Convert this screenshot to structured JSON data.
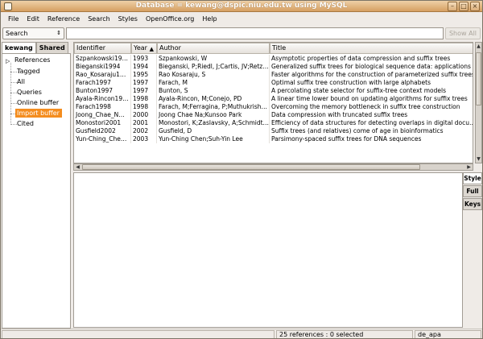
{
  "window": {
    "title": "Database = kewang@dspic.niu.edu.tw using MySQL"
  },
  "menu": [
    "File",
    "Edit",
    "Reference",
    "Search",
    "Styles",
    "OpenOffice.org",
    "Help"
  ],
  "toolbar": {
    "search_mode": "Search",
    "search_value": "",
    "show_all_label": "Show All"
  },
  "tabs": [
    {
      "label": "kewang",
      "active": true
    },
    {
      "label": "Shared",
      "active": false
    }
  ],
  "tree": {
    "root": "References",
    "children": [
      "Tagged",
      "All",
      "Queries",
      "Online buffer",
      "Import buffer",
      "Cited"
    ],
    "selected": "Import buffer"
  },
  "table": {
    "columns": [
      "Identifier",
      "Year",
      "Author",
      "Title"
    ],
    "sort_column": "Year",
    "rows": [
      [
        "Szpankowski19…",
        "1993",
        "Szpankowski, W",
        "Asymptotic properties of data compression and suffix trees"
      ],
      [
        "Bieganski1994",
        "1994",
        "Bieganski, P;Riedl, J;Cartis, JV;Retz…",
        "Generalized suffix trees for biological sequence data: applications …"
      ],
      [
        "Rao_Kosaraju1…",
        "1995",
        "Rao Kosaraju, S",
        "Faster algorithms for the construction of parameterized suffix trees"
      ],
      [
        "Farach1997",
        "1997",
        "Farach, M",
        "Optimal suffix tree construction with large alphabets"
      ],
      [
        "Bunton1997",
        "1997",
        "Bunton, S",
        "A percolating state selector for suffix-tree context models"
      ],
      [
        "Ayala-Rincon19…",
        "1998",
        "Ayala-Rincon, M;Conejo, PD",
        "A linear time lower bound on updating algorithms for suffix trees"
      ],
      [
        "Farach1998",
        "1998",
        "Farach, M;Ferragina, P;Muthukrish…",
        "Overcoming the memory bottleneck in suffix tree construction"
      ],
      [
        "Joong_Chae_N…",
        "2000",
        "Joong Chae Na;Kunsoo Park",
        "Data compression with truncated suffix trees"
      ],
      [
        "Monostori2001",
        "2001",
        "Monostori, K;Zaslavsky, A;Schmidt…",
        "Efficiency of data structures for detecting overlaps in digital docu…"
      ],
      [
        "Gusfield2002",
        "2002",
        "Gusfield, D",
        "Suffix trees (and relatives) come of age in bioinformatics"
      ],
      [
        "Yun-Ching_Che…",
        "2003",
        "Yun-Ching Chen;Suh-Yin Lee",
        "Parsimony-spaced suffix trees for DNA sequences"
      ]
    ]
  },
  "side_tabs": [
    {
      "label": "Style",
      "active": true
    },
    {
      "label": "Full",
      "active": false
    },
    {
      "label": "Keys",
      "active": false
    }
  ],
  "status": {
    "left": "",
    "count": "25 references : 0 selected",
    "style": "de_apa"
  }
}
